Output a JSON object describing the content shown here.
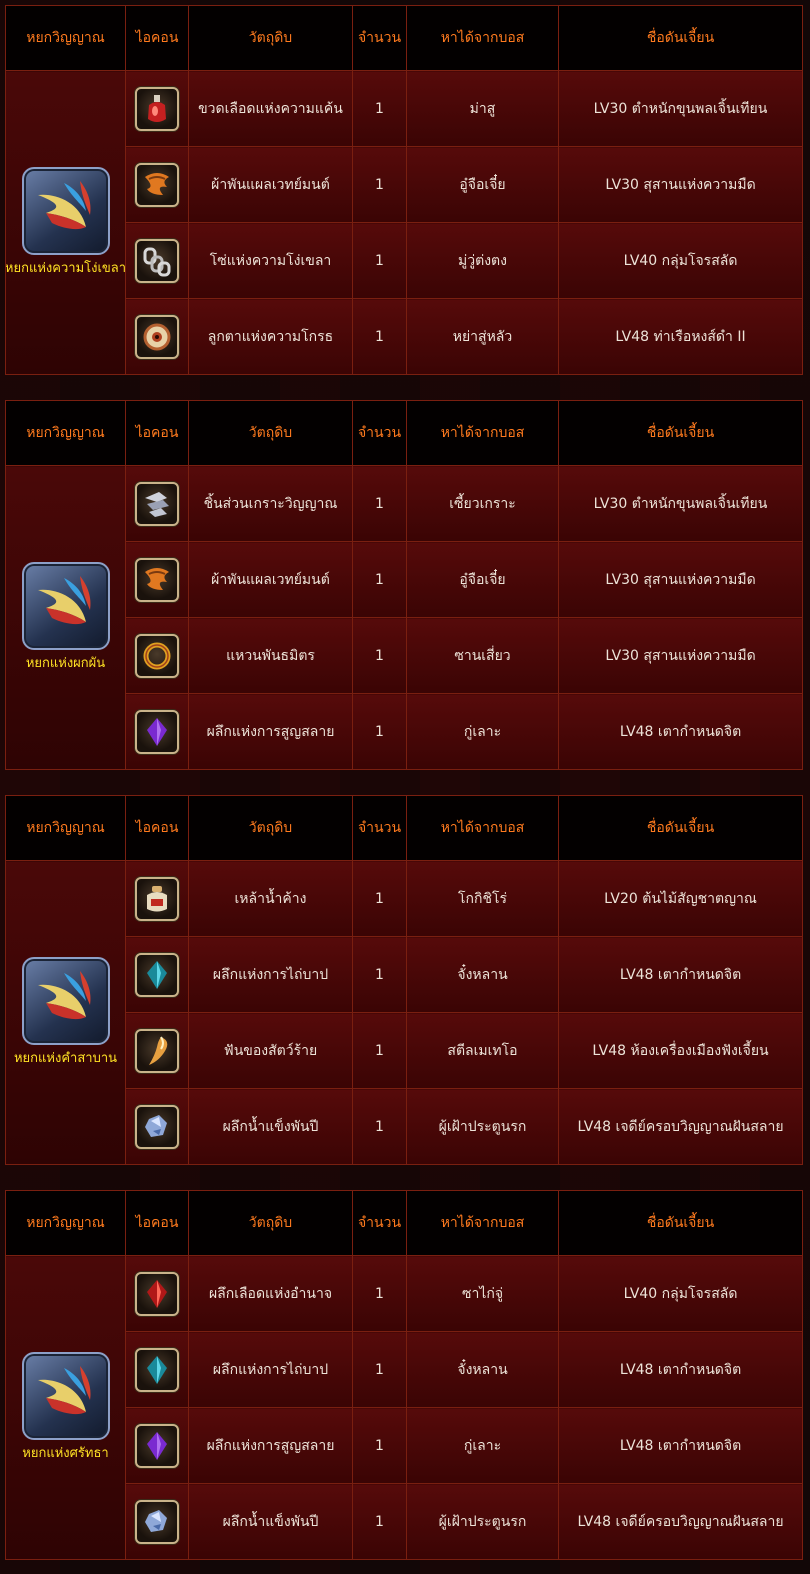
{
  "headers": {
    "jade": "หยกวิญญาณ",
    "icon": "ไอคอน",
    "material": "วัตถุดิบ",
    "qty": "จำนวน",
    "boss": "หาได้จากบอส",
    "dungeon": "ชื่อดันเจี้ยน"
  },
  "groups": [
    {
      "jade_name": "หยกแห่งความโง่เขลา",
      "jade_icon": "soul-jade-icon",
      "items": [
        {
          "icon": "red-potion-bottle-icon",
          "name": "ขวดเลือดแห่งความแค้น",
          "qty": "1",
          "boss": "ม่าสู",
          "dungeon": "LV30 ตำหนักขุนพลเจิ้นเทียน"
        },
        {
          "icon": "orange-cloth-wrap-icon",
          "name": "ผ้าพันแผลเวทย์มนต์",
          "qty": "1",
          "boss": "อู๋จือเจี๋ย",
          "dungeon": "LV30 สุสานแห่งความมืด"
        },
        {
          "icon": "chain-link-icon",
          "name": "โซ่แห่งความโง่เขลา",
          "qty": "1",
          "boss": "มู่วู่ต่งตง",
          "dungeon": "LV40 กลุ่มโจรสลัด"
        },
        {
          "icon": "eyeball-orb-icon",
          "name": "ลูกตาแห่งความโกรธ",
          "qty": "1",
          "boss": "หย่าสู่หลัว",
          "dungeon": "LV48 ท่าเรือหงส์ดำ II"
        }
      ]
    },
    {
      "jade_name": "หยกแห่งผกผัน",
      "jade_icon": "soul-jade-icon",
      "items": [
        {
          "icon": "silver-shard-fragment-icon",
          "name": "ชิ้นส่วนเกราะวิญญาณ",
          "qty": "1",
          "boss": "เซี้ยวเกราะ",
          "dungeon": "LV30 ตำหนักขุนพลเจิ้นเทียน"
        },
        {
          "icon": "orange-cloth-wrap-icon",
          "name": "ผ้าพันแผลเวทย์มนต์",
          "qty": "1",
          "boss": "อู๋จือเจี๋ย",
          "dungeon": "LV30 สุสานแห่งความมืด"
        },
        {
          "icon": "gold-ring-icon",
          "name": "แหวนพันธมิตร",
          "qty": "1",
          "boss": "ซานเสี่ยว",
          "dungeon": "LV30 สุสานแห่งความมืด"
        },
        {
          "icon": "purple-crystal-icon",
          "name": "ผลึกแห่งการสูญสลาย",
          "qty": "1",
          "boss": "กู่เลาะ",
          "dungeon": "LV48 เตากำหนดจิต"
        }
      ]
    },
    {
      "jade_name": "หยกแห่งคำสาบาน",
      "jade_icon": "soul-jade-icon",
      "items": [
        {
          "icon": "wine-jar-icon",
          "name": "เหล้าน้ำค้าง",
          "qty": "1",
          "boss": "โกกิชิโร่",
          "dungeon": "LV20 ต้นไม้สัญชาตญาณ"
        },
        {
          "icon": "teal-crystal-icon",
          "name": "ผลึกแห่งการไถ่บาป",
          "qty": "1",
          "boss": "จั๋งหลาน",
          "dungeon": "LV48 เตากำหนดจิต"
        },
        {
          "icon": "beast-fang-icon",
          "name": "ฟันของสัตว์ร้าย",
          "qty": "1",
          "boss": "สตีลเมเทโอ",
          "dungeon": "LV48 ห้องเครื่องเมืองฟังเจี้ยน"
        },
        {
          "icon": "ice-crystal-icon",
          "name": "ผลึกน้ำแข็งพันปี",
          "qty": "1",
          "boss": "ผู้เฝ้าประตูนรก",
          "dungeon": "LV48 เจดีย์ครอบวิญญาณฝันสลาย"
        }
      ]
    },
    {
      "jade_name": "หยกแห่งศรัทธา",
      "jade_icon": "soul-jade-icon",
      "items": [
        {
          "icon": "red-crystal-icon",
          "name": "ผลึกเลือดแห่งอำนาจ",
          "qty": "1",
          "boss": "ซาไก่จู่",
          "dungeon": "LV40 กลุ่มโจรสลัด"
        },
        {
          "icon": "teal-crystal-icon",
          "name": "ผลึกแห่งการไถ่บาป",
          "qty": "1",
          "boss": "จั๋งหลาน",
          "dungeon": "LV48 เตากำหนดจิต"
        },
        {
          "icon": "purple-crystal-icon",
          "name": "ผลึกแห่งการสูญสลาย",
          "qty": "1",
          "boss": "กู่เลาะ",
          "dungeon": "LV48 เตากำหนดจิต"
        },
        {
          "icon": "ice-crystal-icon",
          "name": "ผลึกน้ำแข็งพันปี",
          "qty": "1",
          "boss": "ผู้เฝ้าประตูนรก",
          "dungeon": "LV48 เจดีย์ครอบวิญญาณฝันสลาย"
        }
      ]
    }
  ]
}
